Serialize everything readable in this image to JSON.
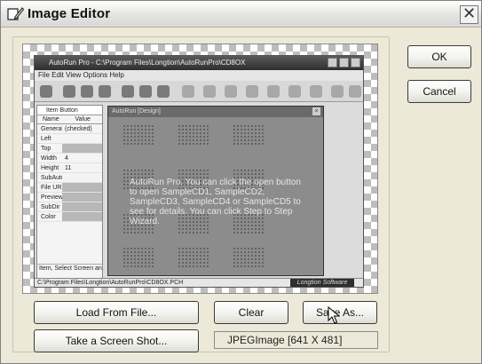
{
  "window": {
    "title": "Image Editor",
    "close_glyph": "✕"
  },
  "buttons": {
    "ok": "OK",
    "cancel": "Cancel",
    "load_from_file": "Load From File...",
    "clear": "Clear",
    "save_as": "Save As...",
    "take_screenshot": "Take a Screen Shot..."
  },
  "image_info": "JPEGImage  [641 X 481]",
  "preview": {
    "title": "AutoRun Pro - C:\\Program Files\\Longtion\\AutoRunPro\\CD8OX",
    "menu": "File  Edit  View  Options  Help",
    "props_header": "Item  Button",
    "props_cols": [
      "Name",
      "Value"
    ],
    "props_rows": [
      {
        "k": "General",
        "v": "(checked)",
        "shade": false
      },
      {
        "k": "Left",
        "v": "",
        "shade": false
      },
      {
        "k": "Top",
        "v": "",
        "shade": true
      },
      {
        "k": "Width",
        "v": "4",
        "shade": false
      },
      {
        "k": "Height",
        "v": "11",
        "shade": false
      },
      {
        "k": "SubAutoRun",
        "v": "",
        "shade": false
      },
      {
        "k": "File URL",
        "v": "",
        "shade": true
      },
      {
        "k": "Preview",
        "v": "",
        "shade": true
      },
      {
        "k": "SubDir",
        "v": "",
        "shade": true
      },
      {
        "k": "Color",
        "v": "",
        "shade": true
      }
    ],
    "props_status": "Item, Select Screen and Item",
    "statusbar": "C:\\Program Files\\Longtion\\AutoRunPro\\CD8OX.PCH",
    "brand": "Longtion Software",
    "canvas_title": "AutoRun [Design]",
    "canvas_text": "AutoRun Pro. You can click the open button to open SampleCD1, SampleCD2, SampleCD3, SampleCD4 or SampleCD5 to see for details. You can click Step to Step Wizard."
  },
  "icons": {
    "title": "image-editor-icon",
    "close": "close-icon",
    "cursor": "mouse-pointer-icon"
  }
}
